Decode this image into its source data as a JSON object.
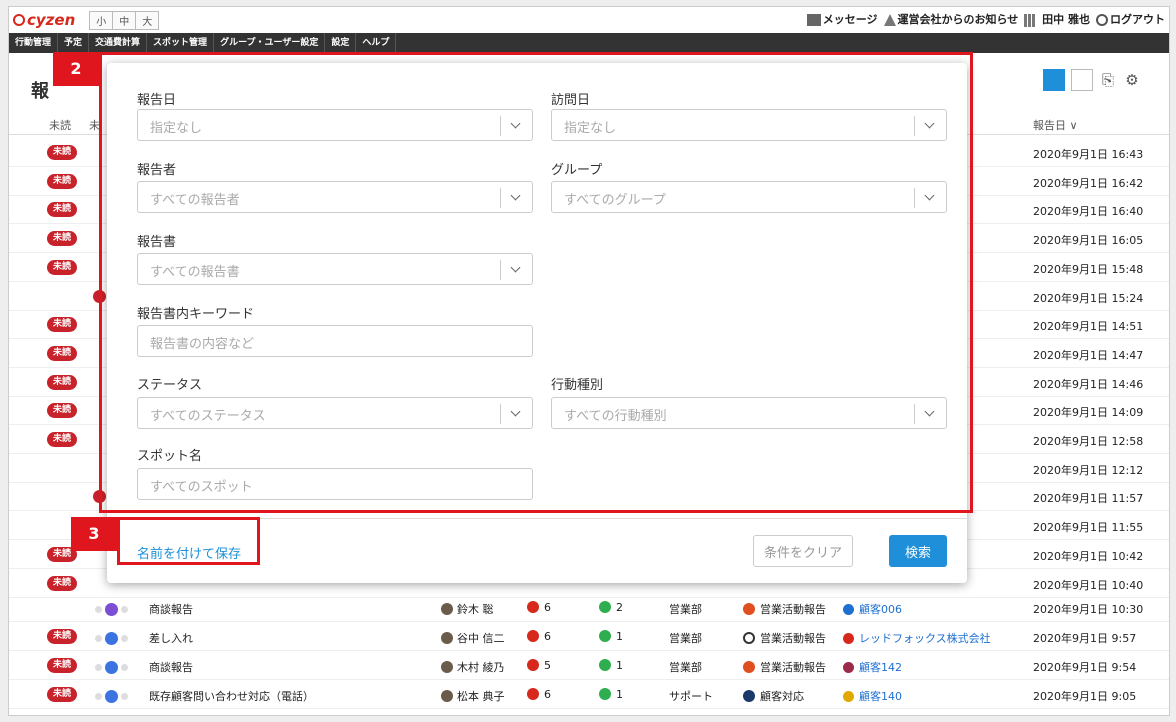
{
  "app": {
    "logo": "cyzen"
  },
  "font_sizes": [
    "小",
    "中",
    "大"
  ],
  "top_links": {
    "message": "メッセージ",
    "notice": "運営会社からのお知らせ",
    "user": "田中 雅也",
    "logout": "ログアウト"
  },
  "nav": [
    "行動管理",
    "予定",
    "交通費計算",
    "スポット管理",
    "グループ・ユーザー設定",
    "設定",
    "ヘルプ"
  ],
  "page": {
    "title_fragment": "報",
    "col_unread": "未読",
    "col_second": "未",
    "col_date": "報告日 ∨"
  },
  "unread_label": "未読",
  "rows": [
    {
      "unread": true,
      "date": "2020年9月1日 16:43"
    },
    {
      "unread": true,
      "date": "2020年9月1日 16:42"
    },
    {
      "unread": true,
      "date": "2020年9月1日 16:40"
    },
    {
      "unread": true,
      "date": "2020年9月1日 16:05"
    },
    {
      "unread": true,
      "date": "2020年9月1日 15:48"
    },
    {
      "unread": false,
      "date": "2020年9月1日 15:24"
    },
    {
      "unread": true,
      "date": "2020年9月1日 14:51"
    },
    {
      "unread": true,
      "date": "2020年9月1日 14:47"
    },
    {
      "unread": true,
      "date": "2020年9月1日 14:46"
    },
    {
      "unread": true,
      "date": "2020年9月1日 14:09"
    },
    {
      "unread": true,
      "date": "2020年9月1日 12:58"
    },
    {
      "unread": false,
      "date": "2020年9月1日 12:12"
    },
    {
      "unread": false,
      "date": "2020年9月1日 11:57"
    },
    {
      "unread": false,
      "date": "2020年9月1日 11:55"
    },
    {
      "unread": true,
      "date": "2020年9月1日 10:42"
    },
    {
      "unread": true,
      "date": "2020年9月1日 10:40"
    }
  ],
  "full_rows": [
    {
      "unread": false,
      "title": "商談報告",
      "reporter": "鈴木 聡",
      "likes": "6",
      "comments": "2",
      "group": "営業部",
      "activity": "営業活動報告",
      "spot": "顧客006",
      "date": "2020年9月1日 10:30"
    },
    {
      "unread": true,
      "title": "差し入れ",
      "reporter": "谷中 信二",
      "likes": "6",
      "comments": "1",
      "group": "営業部",
      "activity": "営業活動報告",
      "spot": "レッドフォックス株式会社",
      "date": "2020年9月1日 9:57"
    },
    {
      "unread": true,
      "title": "商談報告",
      "reporter": "木村 綾乃",
      "likes": "5",
      "comments": "1",
      "group": "営業部",
      "activity": "営業活動報告",
      "spot": "顧客142",
      "date": "2020年9月1日 9:54"
    },
    {
      "unread": true,
      "title": "既存顧客問い合わせ対応（電話）",
      "reporter": "松本 典子",
      "likes": "6",
      "comments": "1",
      "group": "サポート",
      "activity": "顧客対応",
      "spot": "顧客140",
      "date": "2020年9月1日 9:05"
    }
  ],
  "filter": {
    "report_date": {
      "label": "報告日",
      "placeholder": "指定なし"
    },
    "visit_date": {
      "label": "訪問日",
      "placeholder": "指定なし"
    },
    "reporter": {
      "label": "報告者",
      "placeholder": "すべての報告者"
    },
    "group": {
      "label": "グループ",
      "placeholder": "すべてのグループ"
    },
    "report_form": {
      "label": "報告書",
      "placeholder": "すべての報告書"
    },
    "keyword": {
      "label": "報告書内キーワード",
      "placeholder": "報告書の内容など"
    },
    "status": {
      "label": "ステータス",
      "placeholder": "すべてのステータス"
    },
    "activity_type": {
      "label": "行動種別",
      "placeholder": "すべての行動種別"
    },
    "spot_name": {
      "label": "スポット名",
      "placeholder": "すべてのスポット"
    },
    "save_label": "名前を付けて保存",
    "clear_label": "条件をクリア",
    "search_label": "検索"
  },
  "callouts": {
    "two": "2",
    "three": "3"
  },
  "colors": {
    "accent": "#1e8fd8",
    "unread": "#c8222b",
    "callout": "#e0161e",
    "nav": "#333333"
  }
}
